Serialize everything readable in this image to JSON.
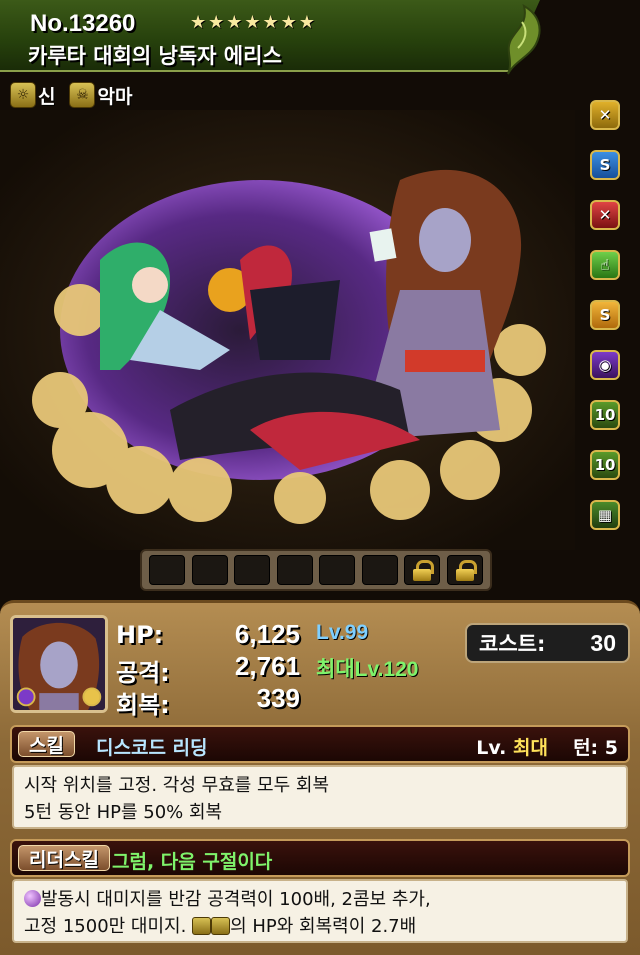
{
  "header": {
    "number": "No.13260",
    "rarity_stars": "★★★★★★★",
    "name": "카루타 대회의 낭독자 에리스"
  },
  "types": [
    {
      "icon": "god-type-icon",
      "label": "신"
    },
    {
      "icon": "devil-type-icon",
      "label": "악마"
    }
  ],
  "awakenings": [
    "skill-bind-resist-icon",
    "skill-boost-icon",
    "skill-bind-resist-plus-icon",
    "finger-extension-icon",
    "super-skill-boost-icon",
    "dark-combo-icon",
    "combo-orb-10-icon",
    "combo-orb-10-icon-2",
    "orb-grid-icon"
  ],
  "latent_slots": {
    "empty": 6,
    "locked": 2
  },
  "stats": {
    "hp_label": "HP:",
    "hp": "6,125",
    "atk_label": "공격:",
    "atk": "2,761",
    "rcv_label": "회복:",
    "rcv": "339",
    "level": "Lv.99",
    "max_level": "최대Lv.120",
    "cost_label": "코스트:",
    "cost": "30"
  },
  "skill": {
    "tag": "스킬",
    "name": "디스코드 리딩",
    "lv_prefix": "Lv.",
    "lv_value": "최대",
    "turn": "턴: 5",
    "desc_line1": "시작 위치를 고정. 각성 무효를 모두 회복",
    "desc_line2": "5턴 동안 HP를 50% 회복"
  },
  "leader_skill": {
    "tag": "리더스킬",
    "name": "그럼, 다음 구절이다",
    "desc_line1": "발동시 대미지를 반감 공격력이 100배, 2콤보 추가,",
    "desc_line2a": "고정 1500만 대미지.",
    "desc_line2b": "의 HP와 회복력이 2.7배"
  },
  "colors": {
    "header_green": "#3c5a18",
    "panel_brown": "#9c7843",
    "level_blue": "#7ecfff",
    "max_level_green": "#7ff36b",
    "skill_name_blue": "#b8e6ff"
  }
}
